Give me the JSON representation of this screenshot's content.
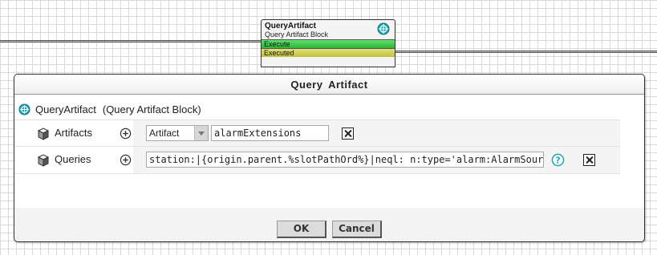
{
  "node": {
    "title": "QueryArtifact",
    "subtitle": "Query Artifact Block",
    "ports": [
      "Execute",
      "Executed"
    ],
    "icon": "target-icon"
  },
  "dialog": {
    "title": "Query  Artifact",
    "header": {
      "label": "QueryArtifact",
      "type": "(Query Artifact Block)"
    },
    "rows": [
      {
        "label": "Artifacts",
        "select_value": "Artifact",
        "value": "alarmExtensions"
      },
      {
        "label": "Queries",
        "value": "station:|{origin.parent.%slotPathOrd%}|neql: n:type='alarm:AlarmSourceExt'"
      }
    ],
    "ok_label": "OK",
    "cancel_label": "Cancel"
  },
  "colors": {
    "execute_port": "#2fb43a",
    "executed_port": "#bfbf3a",
    "icon_teal": "#1aa7b5"
  }
}
